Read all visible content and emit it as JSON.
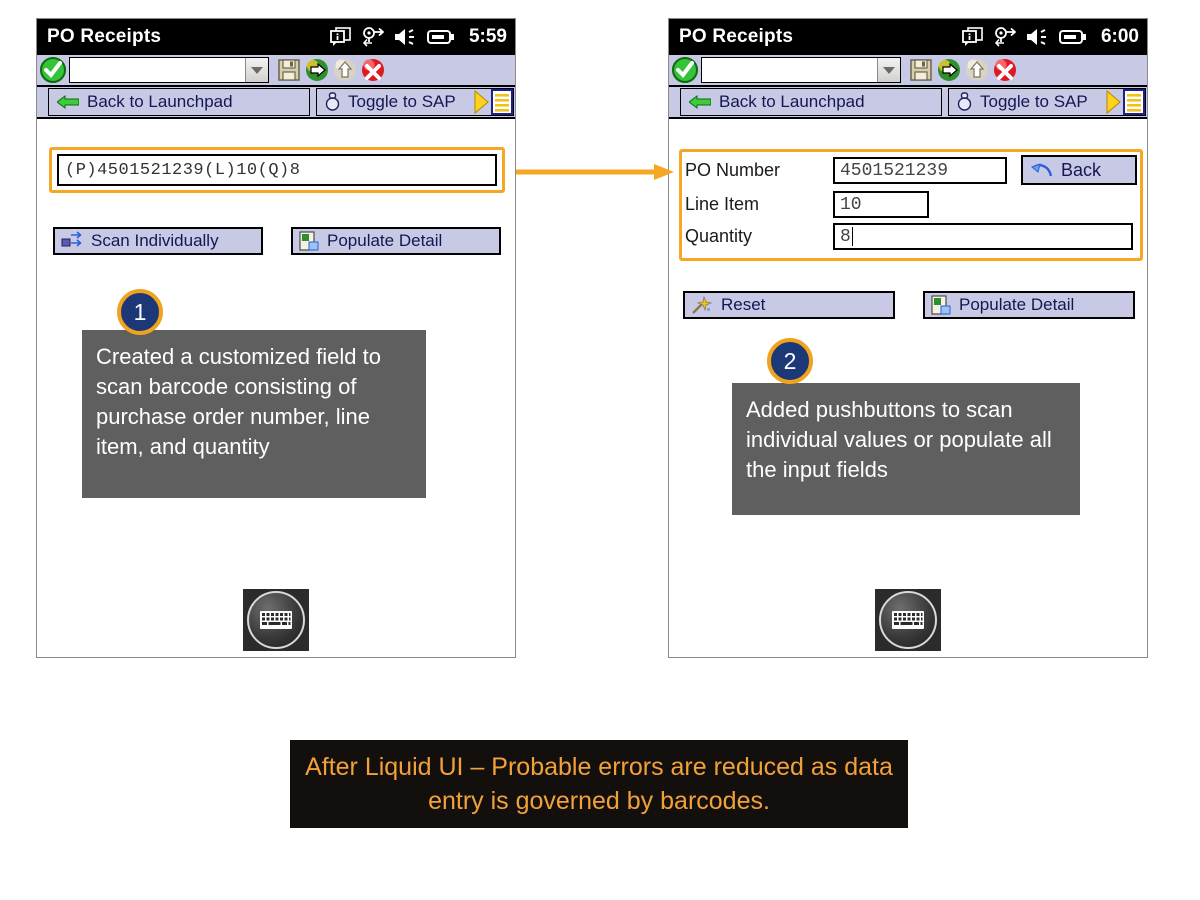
{
  "left_device": {
    "titlebar": {
      "title": "PO Receipts",
      "clock": "5:59",
      "icons": [
        "info-balloon-icon",
        "connectivity-icon",
        "speaker-icon",
        "battery-icon"
      ]
    },
    "toolbar": {
      "ok_icon": "green-check-icon",
      "command_field_value": "",
      "dropdown_icon": "chevron-down-icon",
      "buttons": [
        "save-icon",
        "back-icon",
        "exit-icon",
        "cancel-icon"
      ]
    },
    "nav": {
      "back_label": "Back to Launchpad",
      "back_icon": "left-arrow-icon",
      "toggle_label": "Toggle to SAP",
      "toggle_icon": "bulb-icon",
      "end_icons": [
        "yellow-play-icon",
        "menu-list-icon"
      ]
    },
    "barcode_field": {
      "value": "(P)4501521239(L)10(Q)8",
      "placeholder": ""
    },
    "buttons": {
      "scan_individually": "Scan Individually",
      "scan_individually_icon": "scan-icon",
      "populate_detail": "Populate Detail",
      "populate_detail_icon": "populate-icon"
    },
    "sip_icon": "keyboard-icon"
  },
  "right_device": {
    "titlebar": {
      "title": "PO Receipts",
      "clock": "6:00",
      "icons": [
        "info-balloon-icon",
        "connectivity-icon",
        "speaker-icon",
        "battery-icon"
      ]
    },
    "toolbar": {
      "ok_icon": "green-check-icon",
      "command_field_value": "",
      "dropdown_icon": "chevron-down-icon",
      "buttons": [
        "save-icon",
        "back-icon",
        "exit-icon",
        "cancel-icon"
      ]
    },
    "nav": {
      "back_label": "Back to Launchpad",
      "back_icon": "left-arrow-icon",
      "toggle_label": "Toggle to SAP",
      "toggle_icon": "bulb-icon",
      "end_icons": [
        "yellow-play-icon",
        "menu-list-icon"
      ]
    },
    "form": {
      "po_number_label": "PO Number",
      "po_number_value": "4501521239",
      "line_item_label": "Line Item",
      "line_item_value": "10",
      "quantity_label": "Quantity",
      "quantity_value": "8",
      "back_button_label": "Back",
      "back_button_icon": "back-arrow-icon"
    },
    "buttons": {
      "reset": "Reset",
      "reset_icon": "wand-icon",
      "populate_detail": "Populate Detail",
      "populate_detail_icon": "populate-icon"
    },
    "sip_icon": "keyboard-icon"
  },
  "annotations": {
    "badge_1": "1",
    "badge_2": "2",
    "callout_1": "Created a customized field to scan barcode consisting of purchase order number, line item, and quantity",
    "callout_2": "Added pushbuttons to scan individual values or populate all the input fields",
    "connector_icon": "right-arrow-connector-icon"
  },
  "caption": {
    "text": "After Liquid UI – Probable errors are reduced as data entry is governed by barcodes."
  },
  "colors": {
    "highlight": "#f5a623",
    "badge_fill": "#1d3876",
    "badge_ring": "#f0a31e",
    "callout_bg": "#5f5f5f",
    "caption_bg": "#120f0d",
    "caption_text": "#f2a13a",
    "toolbar_bg": "#c8c9e4",
    "titlebar_bg": "#000000"
  }
}
